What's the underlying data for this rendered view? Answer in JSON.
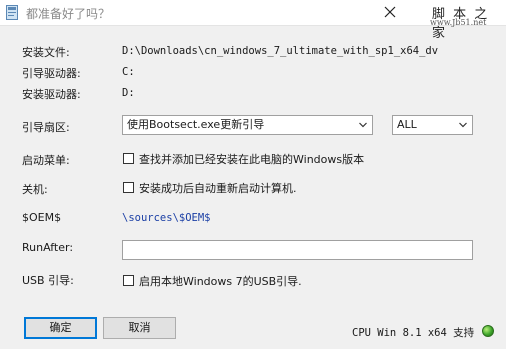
{
  "window": {
    "title": "都准备好了吗？",
    "watermark_title": "脚 本 之 家",
    "watermark_url": "www.Jb51.net"
  },
  "info": {
    "install_file_label": "安装文件:",
    "install_file_value": "D:\\Downloads\\cn_windows_7_ultimate_with_sp1_x64_dv",
    "boot_drive_label": "引导驱动器:",
    "boot_drive_value": "C:",
    "install_drive_label": "安装驱动器:",
    "install_drive_value": "D:"
  },
  "boot_sector": {
    "label": "引导扇区:",
    "method": "使用Bootsect.exe更新引导",
    "scope": "ALL"
  },
  "boot_menu": {
    "label": "启动菜单:",
    "option": "查找并添加已经安装在此电脑的Windows版本"
  },
  "shutdown": {
    "label": "关机:",
    "option": "安装成功后自动重新启动计算机."
  },
  "oem": {
    "label": "$OEM$",
    "link": "\\sources\\$OEM$"
  },
  "run_after": {
    "label": "RunAfter:",
    "value": ""
  },
  "usb_boot": {
    "label": "USB 引导:",
    "option": "启用本地Windows 7的USB引导."
  },
  "buttons": {
    "ok": "确定",
    "cancel": "取消"
  },
  "status": {
    "text": "CPU Win 8.1 x64 支持",
    "led_color": "#3fa62c"
  }
}
